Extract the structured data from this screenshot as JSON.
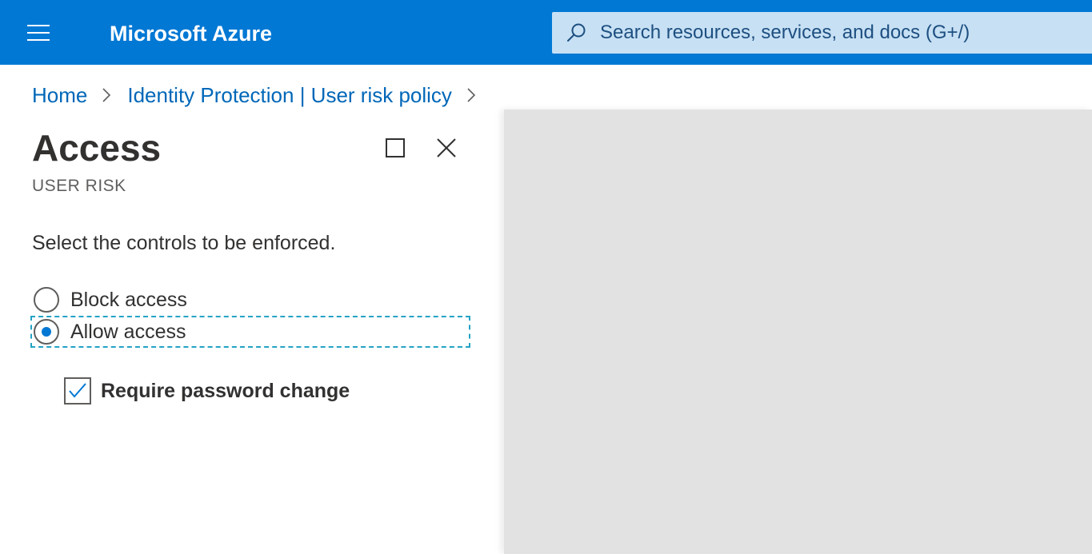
{
  "topbar": {
    "menu_icon": "hamburger-menu-icon",
    "brand": "Microsoft Azure",
    "search": {
      "icon": "search-icon",
      "placeholder": "Search resources, services, and docs (G+/)"
    }
  },
  "breadcrumb": {
    "items": [
      {
        "label": "Home"
      },
      {
        "label": "Identity Protection | User risk policy"
      }
    ],
    "separator_icon": "chevron-right-icon"
  },
  "panel": {
    "title": "Access",
    "subtitle": "USER RISK",
    "maximize_icon": "maximize-icon",
    "close_icon": "close-icon",
    "instruction": "Select the controls to be enforced.",
    "options": [
      {
        "label": "Block access",
        "selected": false
      },
      {
        "label": "Allow access",
        "selected": true
      }
    ],
    "checkbox": {
      "label": "Require password change",
      "checked": true
    }
  },
  "colors": {
    "header_bg": "#0078d4",
    "search_bg": "#c7e0f4",
    "link": "#0067b8",
    "accent": "#0078d4",
    "focus_outline": "#23a3c6",
    "overlay_grey": "#e2e2e2"
  }
}
